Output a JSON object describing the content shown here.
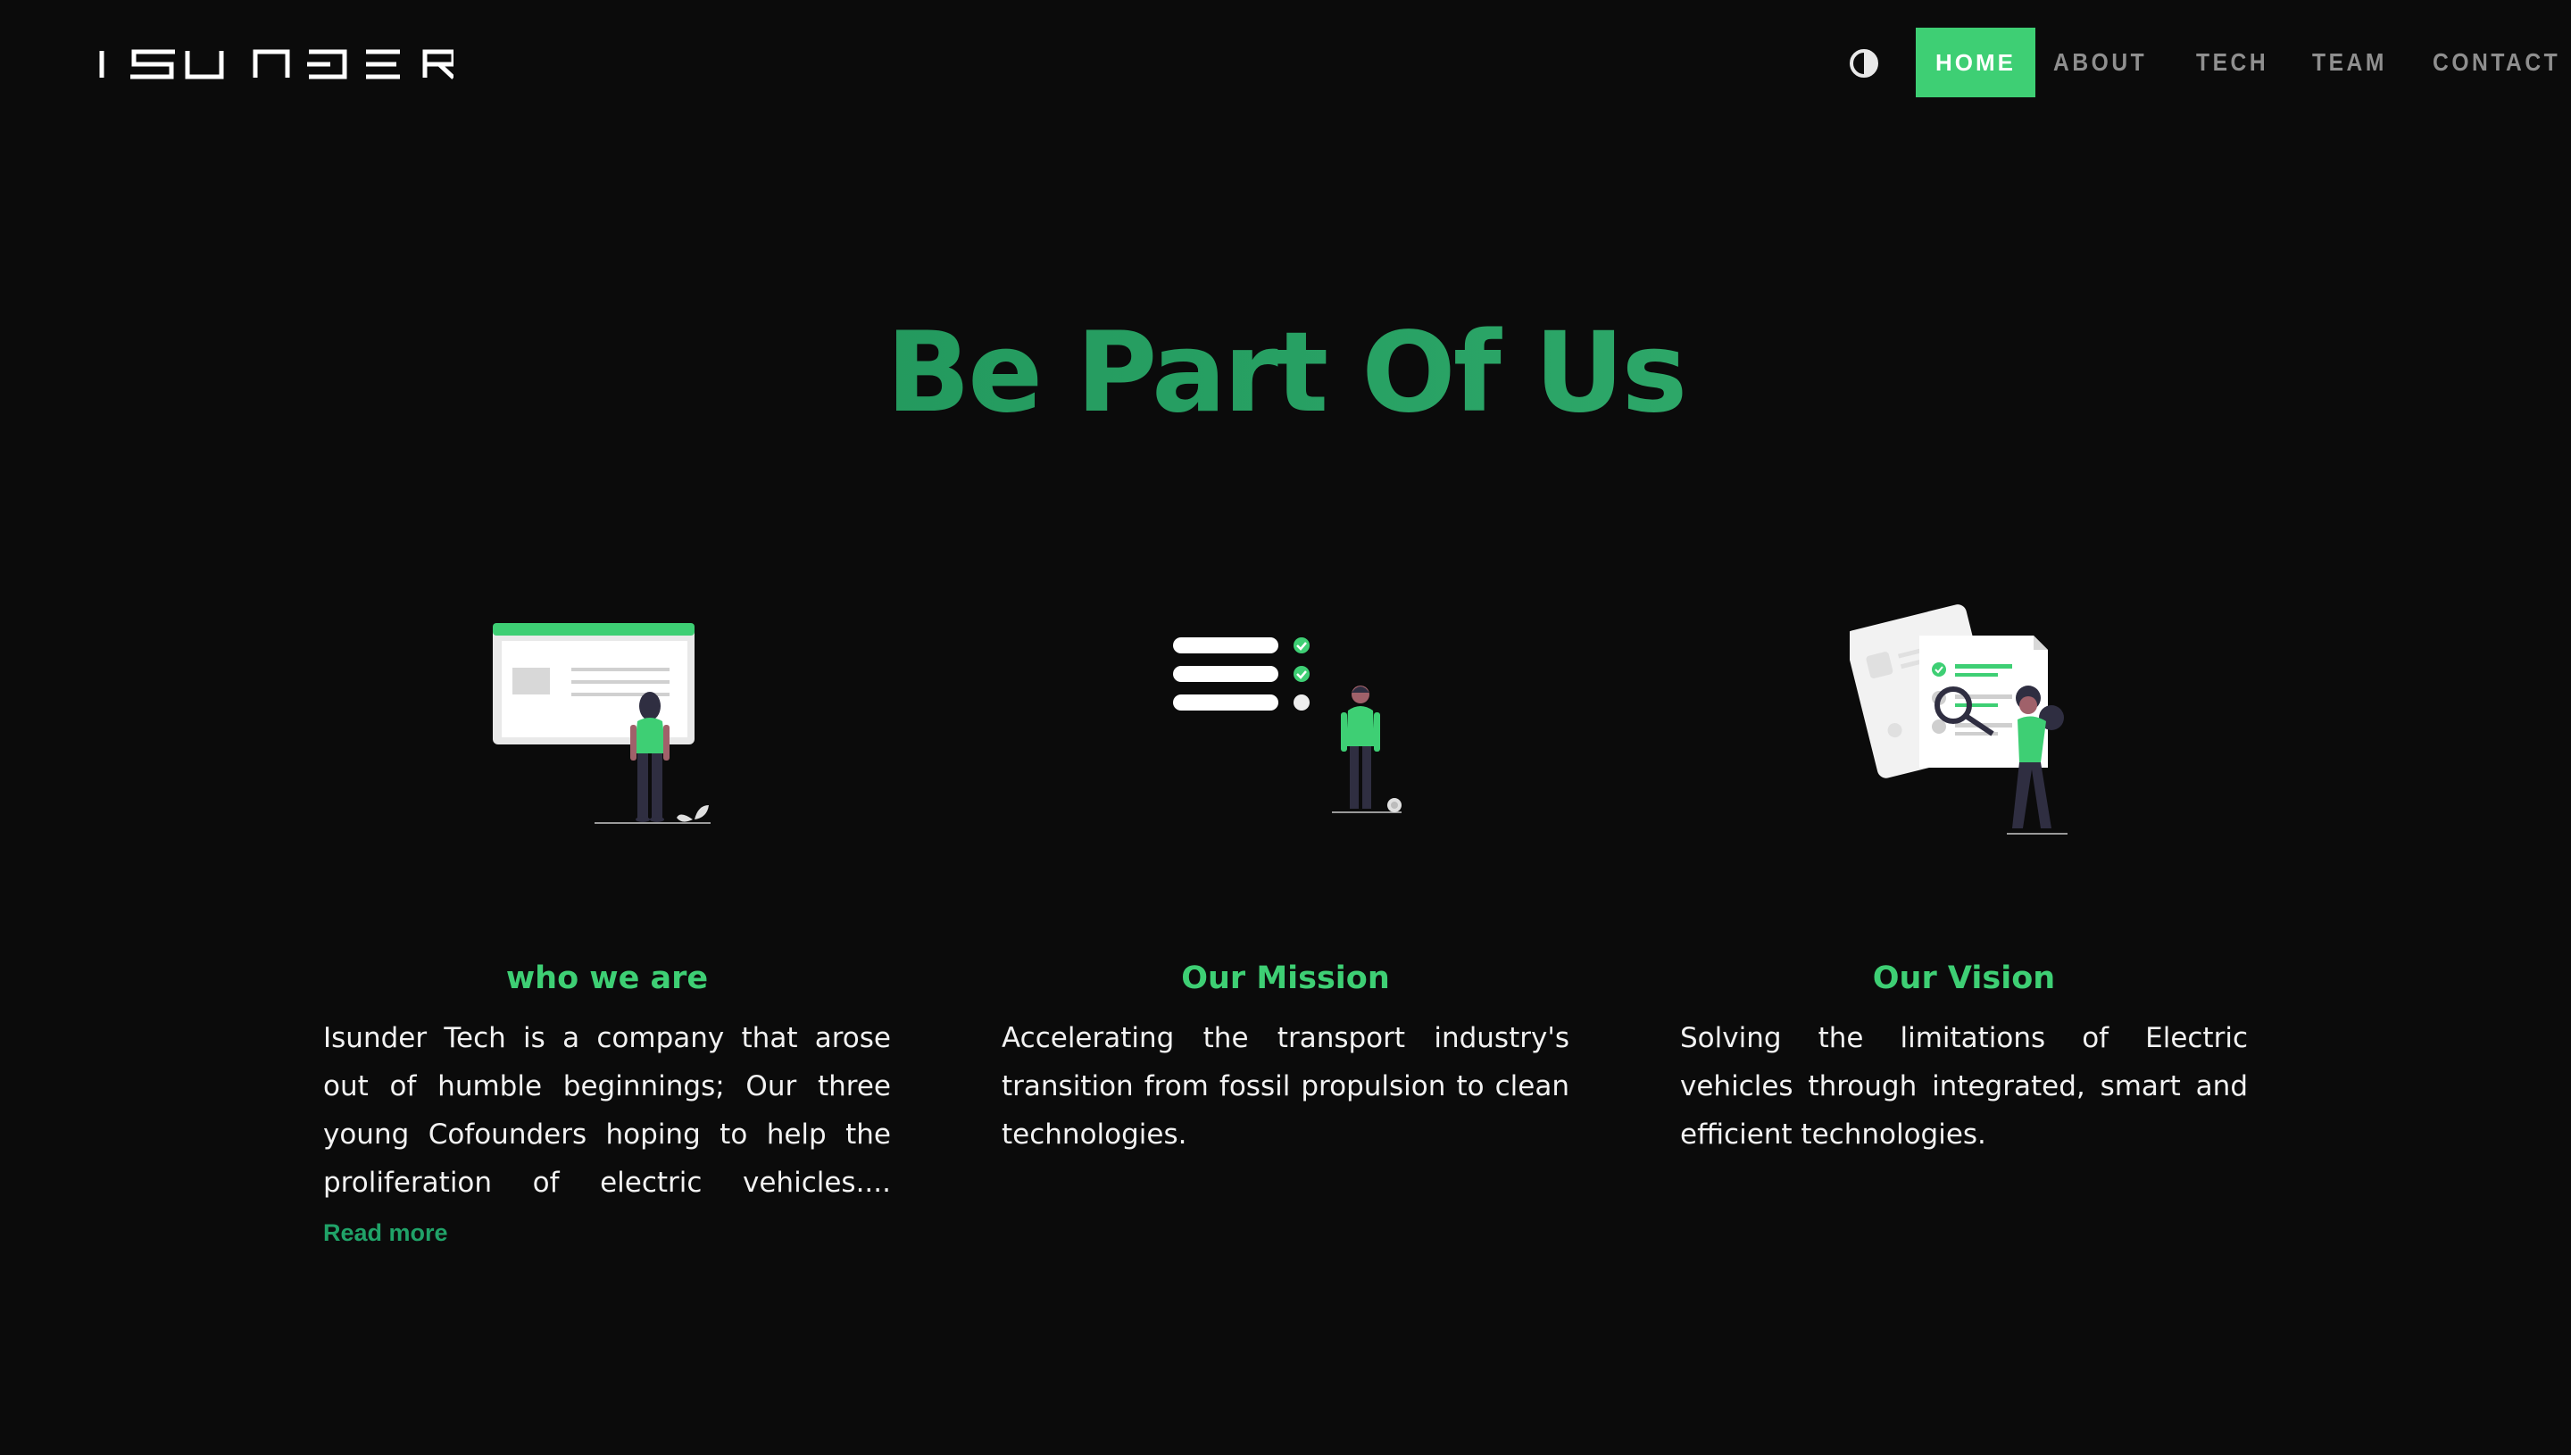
{
  "brand": {
    "logo_text": "ISUNDER",
    "accent_color": "#3ecf74",
    "title_gradient": [
      "#1d8c54",
      "#3bb775"
    ],
    "background": "#0b0b0b"
  },
  "nav": {
    "theme_toggle_icon": "contrast-icon",
    "items": [
      {
        "label": "HOME",
        "active": true
      },
      {
        "label": "ABOUT",
        "active": false
      },
      {
        "label": "TECH",
        "active": false
      },
      {
        "label": "TEAM",
        "active": false
      },
      {
        "label": "CONTACT",
        "active": false
      }
    ]
  },
  "hero": {
    "title": "Be Part Of Us"
  },
  "cards": [
    {
      "illustration": "website-viewer-illustration",
      "title": "who we are",
      "text": "Isunder Tech is a company that arose out of humble beginnings; Our three young Cofounders hoping to help the proliferation of electric vehicles....",
      "link": "Read more"
    },
    {
      "illustration": "checklist-illustration",
      "title": "Our Mission",
      "text": "Accelerating the transport industry's transition from fossil propulsion to clean technologies."
    },
    {
      "illustration": "document-search-illustration",
      "title": "Our Vision",
      "text": "Solving the limitations of Electric vehicles through integrated, smart and efficient technologies."
    }
  ]
}
